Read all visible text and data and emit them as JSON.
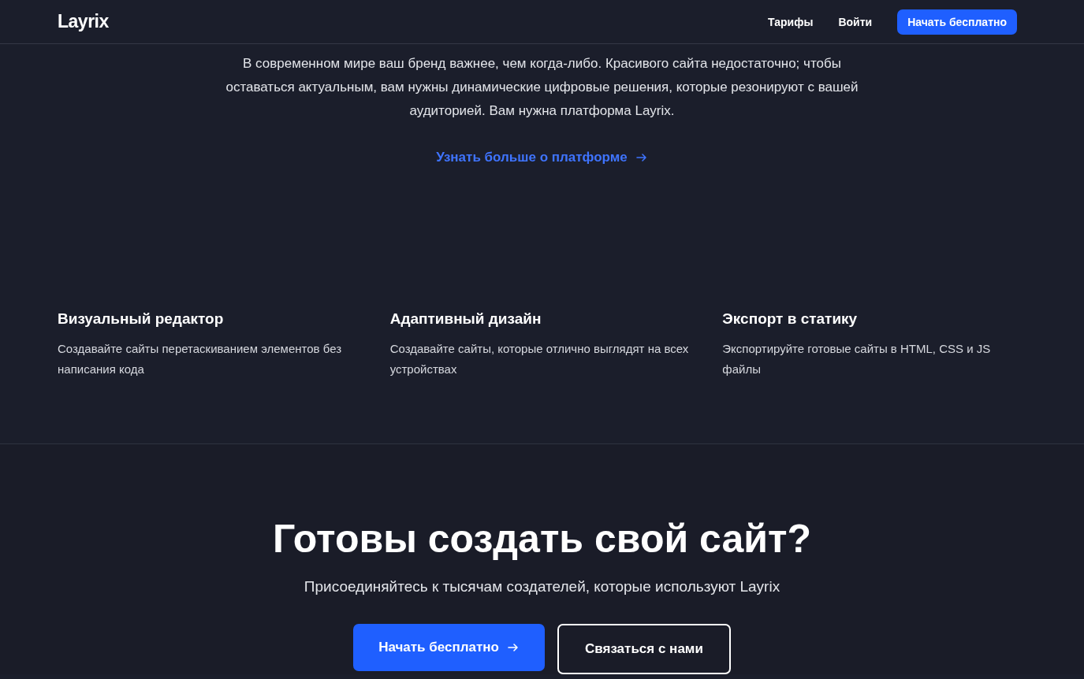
{
  "header": {
    "logo": "Layrix",
    "nav": [
      {
        "label": "Тарифы"
      },
      {
        "label": "Войти"
      }
    ],
    "cta": "Начать бесплатно"
  },
  "hero": {
    "text": "В современном мире ваш бренд важнее, чем когда-либо. Красивого сайта недостаточно; чтобы оставаться актуальным, вам нужны динамические цифровые решения, которые резонируют с вашей аудиторией. Вам нужна платформа Layrix.",
    "link": "Узнать больше о платформе"
  },
  "features": [
    {
      "title": "Визуальный редактор",
      "text": "Создавайте сайты перетаскиванием элементов без написания кода"
    },
    {
      "title": "Адаптивный дизайн",
      "text": "Создавайте сайты, которые отлично выглядят на всех устройствах"
    },
    {
      "title": "Экспорт в статику",
      "text": "Экспортируйте готовые сайты в HTML, CSS и JS файлы"
    }
  ],
  "cta": {
    "title": "Готовы создать свой сайт?",
    "subtitle": "Присоединяйтесь к тысячам создателей, которые используют Layrix",
    "buttons": [
      {
        "label": "Начать бесплатно",
        "kind": "primary"
      },
      {
        "label": "Связаться с нами",
        "kind": "outline"
      }
    ]
  }
}
